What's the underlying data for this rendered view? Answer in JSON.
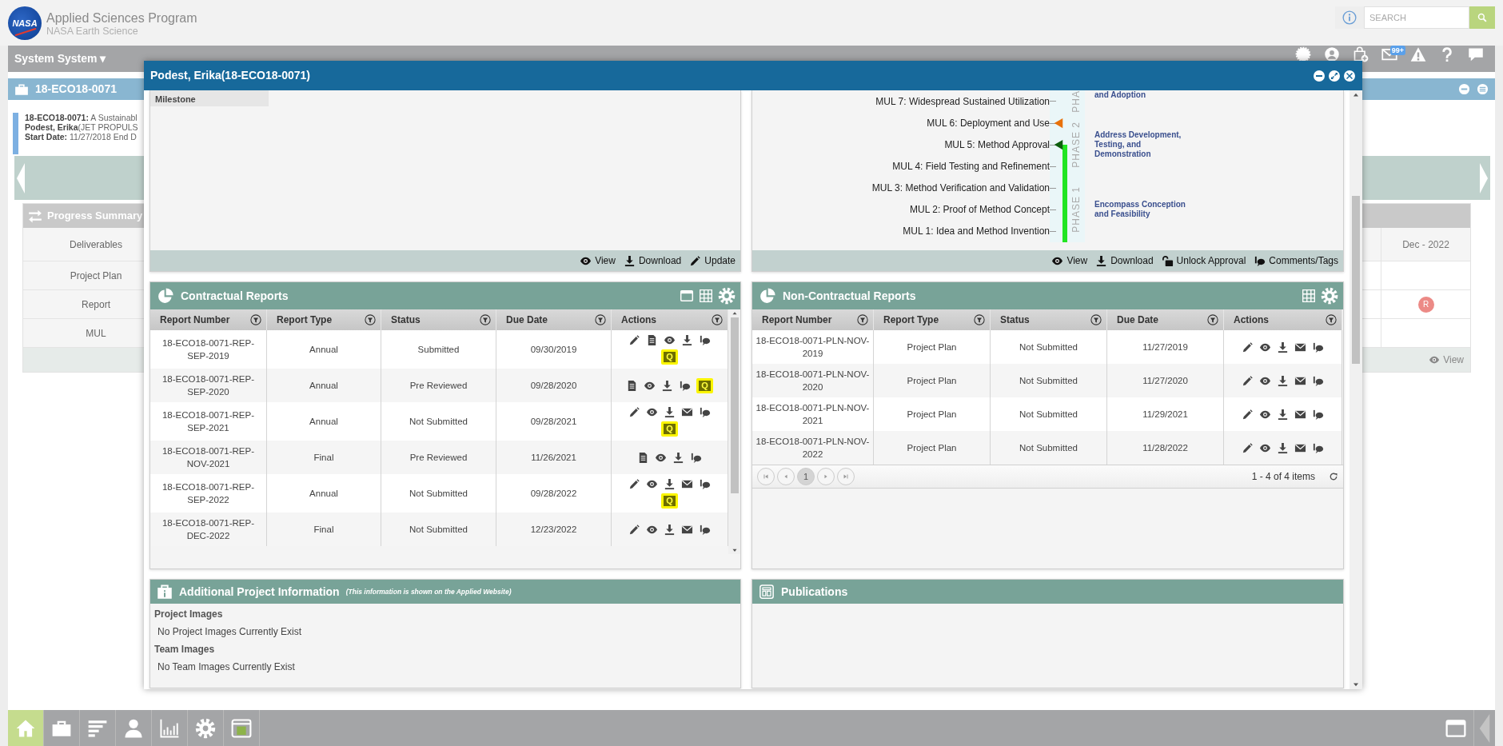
{
  "header": {
    "logo": "NASA",
    "title": "Applied Sciences Program",
    "subtitle": "NASA Earth Science"
  },
  "search": {
    "placeholder": "SEARCH"
  },
  "nav": {
    "user_menu": "System System",
    "caret": "▾",
    "icons": [
      {
        "kind": "new"
      },
      {
        "kind": "user"
      },
      {
        "kind": "bag"
      },
      {
        "kind": "mail",
        "badge": "99+"
      },
      {
        "kind": "alert"
      },
      {
        "kind": "help"
      },
      {
        "kind": "chat"
      }
    ]
  },
  "project": {
    "code": "18-ECO18-0071",
    "summary": [
      "**18-ECO18-0071:** A Sustainabl",
      "**Podest, Erika**(JET PROPULS",
      "**Start Date:** 11/27/2018 End D"
    ]
  },
  "progress_summary": {
    "title": "Progress Summary",
    "corner": "Deliverables",
    "period": "Dec - 2022",
    "rows": [
      {
        "label": "Project Plan"
      },
      {
        "label": "Report",
        "marker": "R"
      },
      {
        "label": "MUL"
      }
    ],
    "footer_action": "View"
  },
  "modal": {
    "title": "Podest, Erika(18-ECO18-0071)",
    "milestone_panel": {
      "column": "Milestone",
      "actions": [
        {
          "kind": "view",
          "label": "View"
        },
        {
          "kind": "download",
          "label": "Download"
        },
        {
          "kind": "edit",
          "label": "Update"
        }
      ]
    },
    "mul_panel": {
      "phases": [
        {
          "label": "PHA",
          "description": "and Adoption",
          "levels": [
            {
              "label": "MUL 7: Widespread Sustained Utilization",
              "reached": false
            }
          ]
        },
        {
          "label": "PHASE 2",
          "description": "Address Development, Testing, and Demonstration",
          "levels": [
            {
              "label": "MUL 6: Deployment and Use",
              "reached": false,
              "color": "#e8710a"
            },
            {
              "label": "MUL 5: Method Approval",
              "reached": true,
              "color": "#0d5e0d"
            },
            {
              "label": "MUL 4: Field Testing and Refinement",
              "reached": true
            }
          ]
        },
        {
          "label": "PHASE 1",
          "description": "Encompass Conception and Feasibility",
          "levels": [
            {
              "label": "MUL 3: Method Verification and Validation",
              "reached": true
            },
            {
              "label": "MUL 2: Proof of Method Concept",
              "reached": true
            },
            {
              "label": "MUL 1: Idea and Method Invention",
              "reached": true
            }
          ]
        }
      ],
      "actions": [
        {
          "kind": "view",
          "label": "View"
        },
        {
          "kind": "download",
          "label": "Download"
        },
        {
          "kind": "unlock",
          "label": "Unlock Approval"
        },
        {
          "kind": "comments",
          "label": "Comments/Tags"
        }
      ]
    },
    "contractual_reports": {
      "title": "Contractual Reports",
      "tools": [
        {
          "kind": "window"
        },
        {
          "kind": "grid"
        },
        {
          "kind": "settings"
        }
      ],
      "columns": [
        "Report Number",
        "Report Type",
        "Status",
        "Due Date",
        "Actions"
      ],
      "rows": [
        {
          "cells": [
            "18-ECO18-0071-REP-SEP-2019",
            "Annual",
            "Submitted",
            "09/30/2019"
          ],
          "actions": [
            {
              "kind": "edit"
            },
            {
              "kind": "doc"
            },
            {
              "kind": "view"
            },
            {
              "kind": "download"
            },
            {
              "kind": "comments"
            },
            {
              "kind": "q",
              "label": "Q"
            }
          ]
        },
        {
          "cells": [
            "18-ECO18-0071-REP-SEP-2020",
            "Annual",
            "Pre Reviewed",
            "09/28/2020"
          ],
          "actions": [
            {
              "kind": "doc"
            },
            {
              "kind": "view"
            },
            {
              "kind": "download"
            },
            {
              "kind": "comments"
            },
            {
              "kind": "q",
              "label": "Q"
            }
          ]
        },
        {
          "cells": [
            "18-ECO18-0071-REP-SEP-2021",
            "Annual",
            "Not Submitted",
            "09/28/2021"
          ],
          "actions": [
            {
              "kind": "edit"
            },
            {
              "kind": "view"
            },
            {
              "kind": "download"
            },
            {
              "kind": "mail"
            },
            {
              "kind": "comments"
            },
            {
              "kind": "q",
              "label": "Q"
            }
          ]
        },
        {
          "cells": [
            "18-ECO18-0071-REP-NOV-2021",
            "Final",
            "Pre Reviewed",
            "11/26/2021"
          ],
          "actions": [
            {
              "kind": "doc"
            },
            {
              "kind": "view"
            },
            {
              "kind": "download"
            },
            {
              "kind": "comments"
            }
          ]
        },
        {
          "cells": [
            "18-ECO18-0071-REP-SEP-2022",
            "Annual",
            "Not Submitted",
            "09/28/2022"
          ],
          "actions": [
            {
              "kind": "edit"
            },
            {
              "kind": "view"
            },
            {
              "kind": "download"
            },
            {
              "kind": "mail"
            },
            {
              "kind": "comments"
            },
            {
              "kind": "q",
              "label": "Q"
            }
          ]
        },
        {
          "cells": [
            "18-ECO18-0071-REP-DEC-2022",
            "Final",
            "Not Submitted",
            "12/23/2022"
          ],
          "actions": [
            {
              "kind": "edit"
            },
            {
              "kind": "view"
            },
            {
              "kind": "download"
            },
            {
              "kind": "mail"
            },
            {
              "kind": "comments"
            }
          ]
        }
      ]
    },
    "non_contractual_reports": {
      "title": "Non-Contractual Reports",
      "tools": [
        {
          "kind": "grid"
        },
        {
          "kind": "settings"
        }
      ],
      "columns": [
        "Report Number",
        "Report Type",
        "Status",
        "Due Date",
        "Actions"
      ],
      "rows": [
        {
          "cells": [
            "18-ECO18-0071-PLN-NOV-2019",
            "Project Plan",
            "Not Submitted",
            "11/27/2019"
          ],
          "actions": [
            {
              "kind": "edit"
            },
            {
              "kind": "view"
            },
            {
              "kind": "download"
            },
            {
              "kind": "mail"
            },
            {
              "kind": "comments"
            }
          ]
        },
        {
          "cells": [
            "18-ECO18-0071-PLN-NOV-2020",
            "Project Plan",
            "Not Submitted",
            "11/27/2020"
          ],
          "actions": [
            {
              "kind": "edit"
            },
            {
              "kind": "view"
            },
            {
              "kind": "download"
            },
            {
              "kind": "mail"
            },
            {
              "kind": "comments"
            }
          ]
        },
        {
          "cells": [
            "18-ECO18-0071-PLN-NOV-2021",
            "Project Plan",
            "Not Submitted",
            "11/29/2021"
          ],
          "actions": [
            {
              "kind": "edit"
            },
            {
              "kind": "view"
            },
            {
              "kind": "download"
            },
            {
              "kind": "mail"
            },
            {
              "kind": "comments"
            }
          ]
        },
        {
          "cells": [
            "18-ECO18-0071-PLN-NOV-2022",
            "Project Plan",
            "Not Submitted",
            "11/28/2022"
          ],
          "actions": [
            {
              "kind": "edit"
            },
            {
              "kind": "view"
            },
            {
              "kind": "download"
            },
            {
              "kind": "mail"
            },
            {
              "kind": "comments"
            }
          ]
        }
      ],
      "pager": {
        "pages": [
          {
            "label": "1",
            "selected": true
          }
        ],
        "summary": "1 - 4 of 4 items"
      }
    },
    "additional_info": {
      "title": "Additional Project Information",
      "note": "(This information is shown on the Applied Website)",
      "sections": [
        {
          "heading": "Project Images",
          "text": "No Project Images Currently Exist"
        },
        {
          "heading": "Team Images",
          "text": "No Team Images Currently Exist"
        }
      ]
    },
    "publications": {
      "title": "Publications"
    }
  },
  "taskbar": {
    "items": [
      {
        "kind": "home",
        "selected": true
      },
      {
        "kind": "briefcase",
        "selected": false
      },
      {
        "kind": "bars",
        "selected": false
      },
      {
        "kind": "person",
        "selected": false
      },
      {
        "kind": "chart",
        "selected": false
      },
      {
        "kind": "settings",
        "selected": false
      },
      {
        "kind": "window-p",
        "selected": false
      }
    ],
    "right": [
      {
        "kind": "window"
      }
    ]
  }
}
